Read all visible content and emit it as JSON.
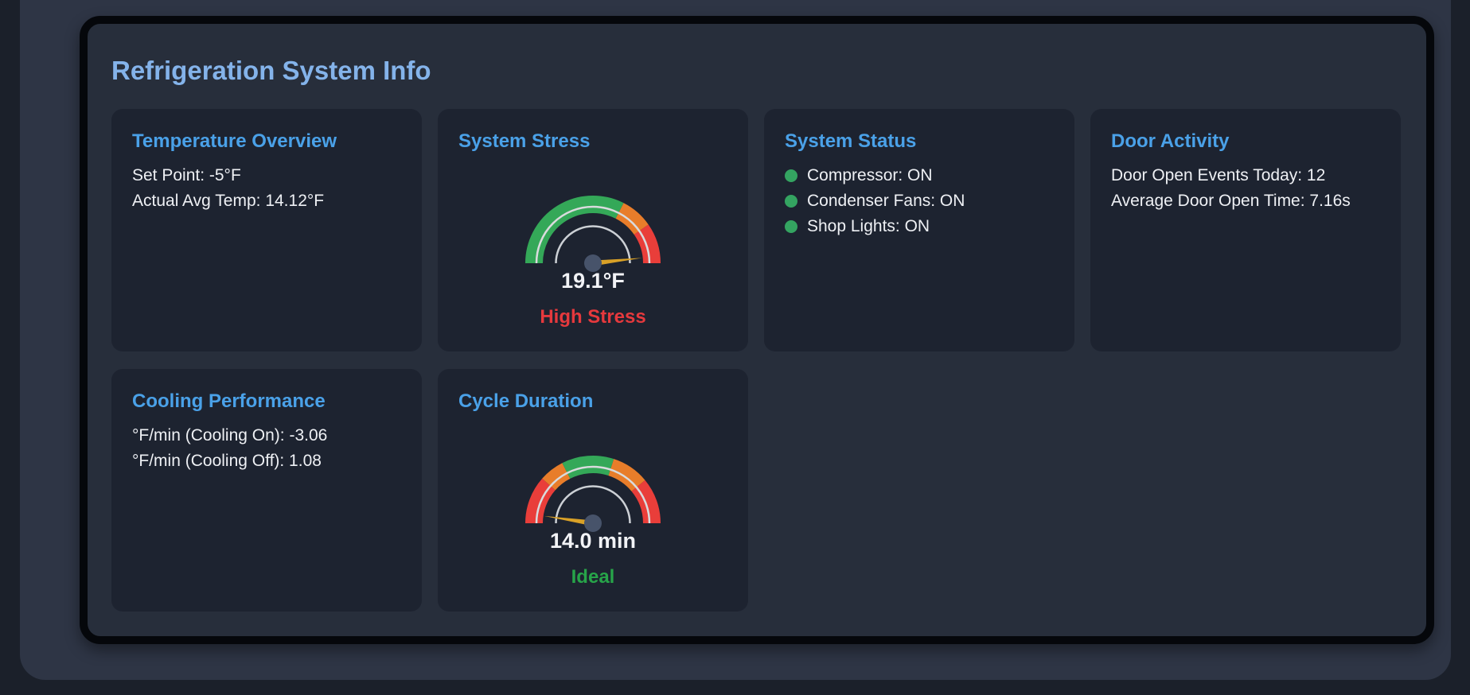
{
  "title": "Refrigeration System Info",
  "colors": {
    "page_bg": "#1b202a",
    "outer_panel_bg": "#2e3545",
    "panel_bg": "#272e3b",
    "card_bg": "#1d2330",
    "page_title": "#84b3ea",
    "card_title": "#4aa1e8",
    "body_text": "#eef0f4",
    "gauge_green": "#34a858",
    "gauge_orange": "#e87d2a",
    "gauge_red": "#e93e3a",
    "needle": "#d9a127",
    "hub": "#47536a"
  },
  "cards": {
    "temperature_overview": {
      "title": "Temperature Overview",
      "lines": [
        "Set Point: -5°F",
        "Actual Avg Temp: 14.12°F"
      ]
    },
    "system_stress": {
      "title": "System Stress",
      "value": "19.1°F",
      "status": "High Stress",
      "status_color": "#e6393d",
      "gauge": {
        "segments": [
          {
            "color": "#34a858",
            "from": 0,
            "to": 0.65
          },
          {
            "color": "#e87d2a",
            "from": 0.65,
            "to": 0.806
          },
          {
            "color": "#e93e3a",
            "from": 0.806,
            "to": 1
          }
        ],
        "needle_fraction": 0.966
      }
    },
    "system_status": {
      "title": "System Status",
      "dot_color": "#34a461",
      "items": [
        "Compressor: ON",
        "Condenser Fans: ON",
        "Shop Lights: ON"
      ]
    },
    "door_activity": {
      "title": "Door Activity",
      "lines": [
        "Door Open Events Today: 12",
        "Average Door Open Time: 7.16s"
      ]
    },
    "cooling_performance": {
      "title": "Cooling Performance",
      "lines": [
        "°F/min (Cooling On): -3.06",
        "°F/min (Cooling Off): 1.08"
      ]
    },
    "cycle_duration": {
      "title": "Cycle Duration",
      "value": "14.0 min",
      "status": "Ideal",
      "status_color": "#27a449",
      "gauge": {
        "segments": [
          {
            "color": "#e93e3a",
            "from": 0,
            "to": 0.23
          },
          {
            "color": "#e87d2a",
            "from": 0.23,
            "to": 0.35
          },
          {
            "color": "#34a858",
            "from": 0.35,
            "to": 0.6
          },
          {
            "color": "#e87d2a",
            "from": 0.6,
            "to": 0.78
          },
          {
            "color": "#e93e3a",
            "from": 0.78,
            "to": 1
          }
        ],
        "needle_fraction": 0.047
      }
    }
  },
  "chart_data": [
    {
      "type": "gauge",
      "title": "System Stress",
      "value": 19.1,
      "unit": "°F",
      "display_value": "19.1°F",
      "status": "High Stress",
      "segment_colors_left_to_right": [
        "green",
        "orange",
        "red"
      ],
      "segment_fractions": [
        0.65,
        0.156,
        0.194
      ]
    },
    {
      "type": "gauge",
      "title": "Cycle Duration",
      "value": 14.0,
      "unit": "min",
      "display_value": "14.0 min",
      "status": "Ideal",
      "segment_colors_left_to_right": [
        "red",
        "orange",
        "green",
        "orange",
        "red"
      ],
      "segment_fractions": [
        0.23,
        0.12,
        0.25,
        0.18,
        0.22
      ]
    }
  ]
}
